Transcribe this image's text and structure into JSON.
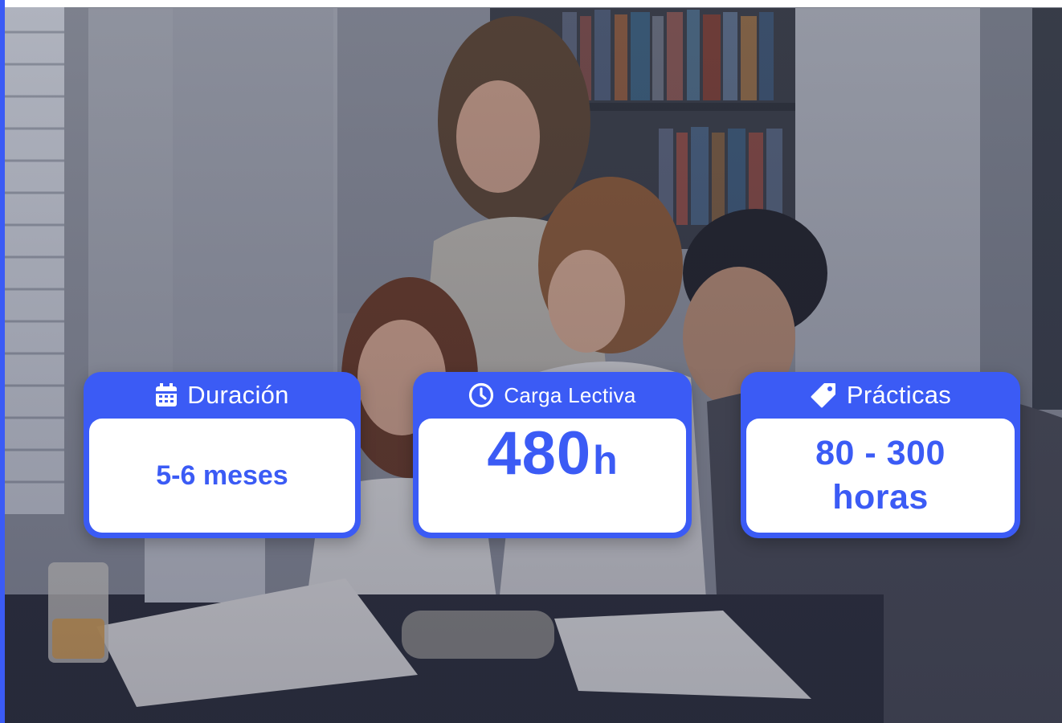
{
  "cards": {
    "duracion": {
      "title": "Duración",
      "icon": "calendar-icon",
      "value": "5-6 meses"
    },
    "carga": {
      "title": "Carga Lectiva",
      "icon": "clock-icon",
      "value_number": "480",
      "value_unit": "h"
    },
    "practicas": {
      "title": "Prácticas",
      "icon": "tag-icon",
      "value_line1": "80 - 300",
      "value_line2": "horas"
    }
  },
  "colors": {
    "accent": "#3b5bf5",
    "card_body": "#ffffff"
  }
}
